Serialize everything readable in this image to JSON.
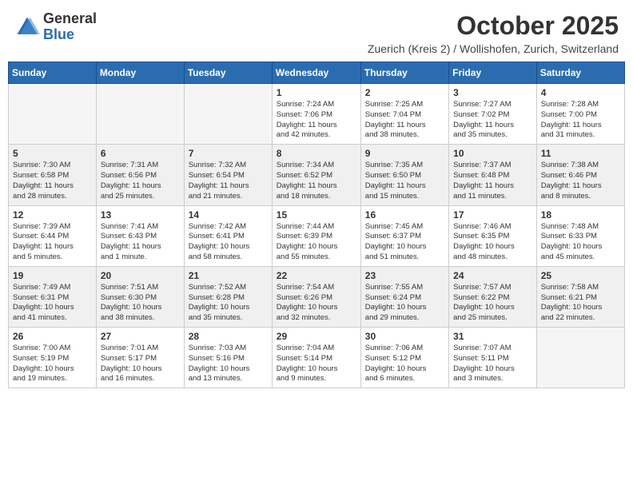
{
  "header": {
    "logo_general": "General",
    "logo_blue": "Blue",
    "month": "October 2025",
    "location": "Zuerich (Kreis 2) / Wollishofen, Zurich, Switzerland"
  },
  "days_of_week": [
    "Sunday",
    "Monday",
    "Tuesday",
    "Wednesday",
    "Thursday",
    "Friday",
    "Saturday"
  ],
  "weeks": [
    [
      {
        "day": "",
        "info": ""
      },
      {
        "day": "",
        "info": ""
      },
      {
        "day": "",
        "info": ""
      },
      {
        "day": "1",
        "info": "Sunrise: 7:24 AM\nSunset: 7:06 PM\nDaylight: 11 hours\nand 42 minutes."
      },
      {
        "day": "2",
        "info": "Sunrise: 7:25 AM\nSunset: 7:04 PM\nDaylight: 11 hours\nand 38 minutes."
      },
      {
        "day": "3",
        "info": "Sunrise: 7:27 AM\nSunset: 7:02 PM\nDaylight: 11 hours\nand 35 minutes."
      },
      {
        "day": "4",
        "info": "Sunrise: 7:28 AM\nSunset: 7:00 PM\nDaylight: 11 hours\nand 31 minutes."
      }
    ],
    [
      {
        "day": "5",
        "info": "Sunrise: 7:30 AM\nSunset: 6:58 PM\nDaylight: 11 hours\nand 28 minutes."
      },
      {
        "day": "6",
        "info": "Sunrise: 7:31 AM\nSunset: 6:56 PM\nDaylight: 11 hours\nand 25 minutes."
      },
      {
        "day": "7",
        "info": "Sunrise: 7:32 AM\nSunset: 6:54 PM\nDaylight: 11 hours\nand 21 minutes."
      },
      {
        "day": "8",
        "info": "Sunrise: 7:34 AM\nSunset: 6:52 PM\nDaylight: 11 hours\nand 18 minutes."
      },
      {
        "day": "9",
        "info": "Sunrise: 7:35 AM\nSunset: 6:50 PM\nDaylight: 11 hours\nand 15 minutes."
      },
      {
        "day": "10",
        "info": "Sunrise: 7:37 AM\nSunset: 6:48 PM\nDaylight: 11 hours\nand 11 minutes."
      },
      {
        "day": "11",
        "info": "Sunrise: 7:38 AM\nSunset: 6:46 PM\nDaylight: 11 hours\nand 8 minutes."
      }
    ],
    [
      {
        "day": "12",
        "info": "Sunrise: 7:39 AM\nSunset: 6:44 PM\nDaylight: 11 hours\nand 5 minutes."
      },
      {
        "day": "13",
        "info": "Sunrise: 7:41 AM\nSunset: 6:43 PM\nDaylight: 11 hours\nand 1 minute."
      },
      {
        "day": "14",
        "info": "Sunrise: 7:42 AM\nSunset: 6:41 PM\nDaylight: 10 hours\nand 58 minutes."
      },
      {
        "day": "15",
        "info": "Sunrise: 7:44 AM\nSunset: 6:39 PM\nDaylight: 10 hours\nand 55 minutes."
      },
      {
        "day": "16",
        "info": "Sunrise: 7:45 AM\nSunset: 6:37 PM\nDaylight: 10 hours\nand 51 minutes."
      },
      {
        "day": "17",
        "info": "Sunrise: 7:46 AM\nSunset: 6:35 PM\nDaylight: 10 hours\nand 48 minutes."
      },
      {
        "day": "18",
        "info": "Sunrise: 7:48 AM\nSunset: 6:33 PM\nDaylight: 10 hours\nand 45 minutes."
      }
    ],
    [
      {
        "day": "19",
        "info": "Sunrise: 7:49 AM\nSunset: 6:31 PM\nDaylight: 10 hours\nand 41 minutes."
      },
      {
        "day": "20",
        "info": "Sunrise: 7:51 AM\nSunset: 6:30 PM\nDaylight: 10 hours\nand 38 minutes."
      },
      {
        "day": "21",
        "info": "Sunrise: 7:52 AM\nSunset: 6:28 PM\nDaylight: 10 hours\nand 35 minutes."
      },
      {
        "day": "22",
        "info": "Sunrise: 7:54 AM\nSunset: 6:26 PM\nDaylight: 10 hours\nand 32 minutes."
      },
      {
        "day": "23",
        "info": "Sunrise: 7:55 AM\nSunset: 6:24 PM\nDaylight: 10 hours\nand 29 minutes."
      },
      {
        "day": "24",
        "info": "Sunrise: 7:57 AM\nSunset: 6:22 PM\nDaylight: 10 hours\nand 25 minutes."
      },
      {
        "day": "25",
        "info": "Sunrise: 7:58 AM\nSunset: 6:21 PM\nDaylight: 10 hours\nand 22 minutes."
      }
    ],
    [
      {
        "day": "26",
        "info": "Sunrise: 7:00 AM\nSunset: 5:19 PM\nDaylight: 10 hours\nand 19 minutes."
      },
      {
        "day": "27",
        "info": "Sunrise: 7:01 AM\nSunset: 5:17 PM\nDaylight: 10 hours\nand 16 minutes."
      },
      {
        "day": "28",
        "info": "Sunrise: 7:03 AM\nSunset: 5:16 PM\nDaylight: 10 hours\nand 13 minutes."
      },
      {
        "day": "29",
        "info": "Sunrise: 7:04 AM\nSunset: 5:14 PM\nDaylight: 10 hours\nand 9 minutes."
      },
      {
        "day": "30",
        "info": "Sunrise: 7:06 AM\nSunset: 5:12 PM\nDaylight: 10 hours\nand 6 minutes."
      },
      {
        "day": "31",
        "info": "Sunrise: 7:07 AM\nSunset: 5:11 PM\nDaylight: 10 hours\nand 3 minutes."
      },
      {
        "day": "",
        "info": ""
      }
    ]
  ]
}
